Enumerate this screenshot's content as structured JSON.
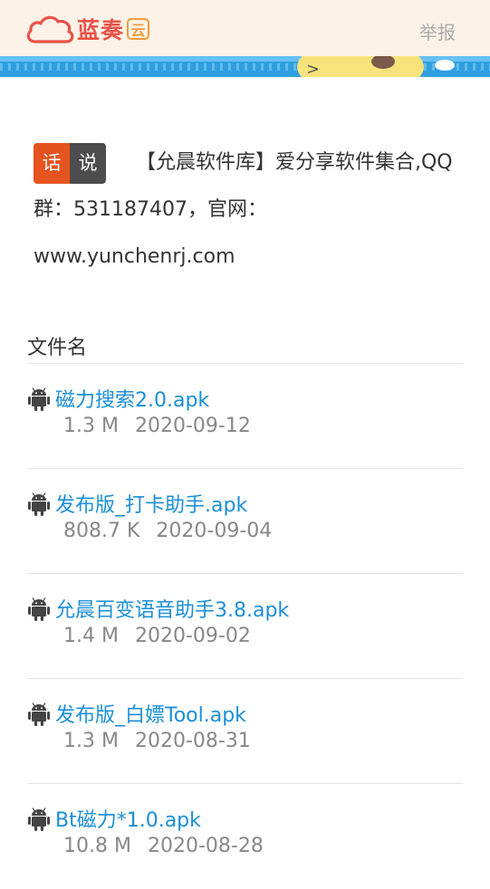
{
  "header": {
    "logo_text": "蓝奏",
    "logo_badge": "云",
    "report_label": "举报",
    "brand_color": "#e8534a"
  },
  "description": {
    "tag_left": "话",
    "tag_right": "说",
    "text": "【允晨软件库】爱分享软件集合,QQ群：531187407，官网：www.yunchenrj.com"
  },
  "files": {
    "column_header": "文件名",
    "items": [
      {
        "name": "磁力搜索2.0.apk",
        "size": "1.3 M",
        "date": "2020-09-12"
      },
      {
        "name": "发布版_打卡助手.apk",
        "size": "808.7 K",
        "date": "2020-09-04"
      },
      {
        "name": "允晨百变语音助手3.8.apk",
        "size": "1.4 M",
        "date": "2020-09-02"
      },
      {
        "name": "发布版_白嫖Tool.apk",
        "size": "1.3 M",
        "date": "2020-08-31"
      },
      {
        "name": "Bt磁力*1.0.apk",
        "size": "10.8 M",
        "date": "2020-08-28"
      }
    ],
    "icon": "android-icon",
    "link_color": "#1a8fd6"
  }
}
